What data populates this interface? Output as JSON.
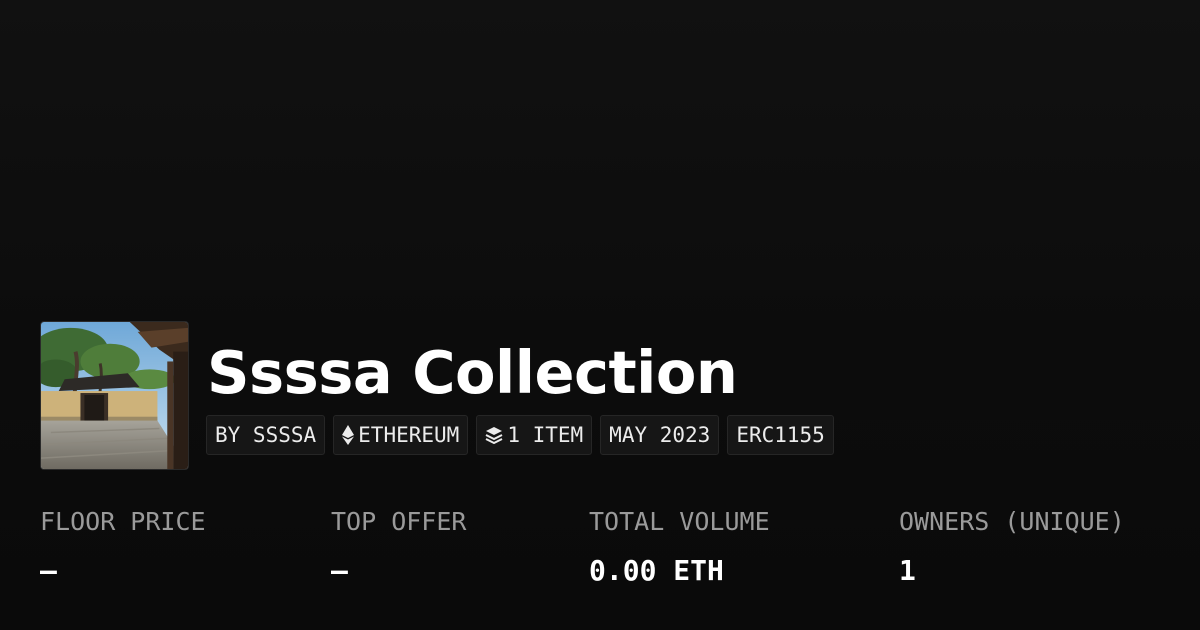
{
  "collection": {
    "title": "Ssssa Collection",
    "thumbnail_alt": "Collection image: Japanese temple gate and pine trees",
    "tags": [
      {
        "label": "BY SSSSA",
        "icon": ""
      },
      {
        "label": "ETHEREUM",
        "icon": "ethereum-icon"
      },
      {
        "label": "1 ITEM",
        "icon": "layers-icon"
      },
      {
        "label": "MAY 2023",
        "icon": ""
      },
      {
        "label": "ERC1155",
        "icon": ""
      }
    ]
  },
  "stats": [
    {
      "label": "FLOOR PRICE",
      "value": "–"
    },
    {
      "label": "TOP OFFER",
      "value": "–"
    },
    {
      "label": "TOTAL VOLUME",
      "value": "0.00 ETH"
    },
    {
      "label": "OWNERS (UNIQUE)",
      "value": "1"
    }
  ],
  "colors": {
    "background": "#0a0a0a",
    "text_primary": "#ffffff",
    "text_secondary": "#9a9a9a",
    "tag_background": "#161616",
    "tag_border": "#262626"
  }
}
